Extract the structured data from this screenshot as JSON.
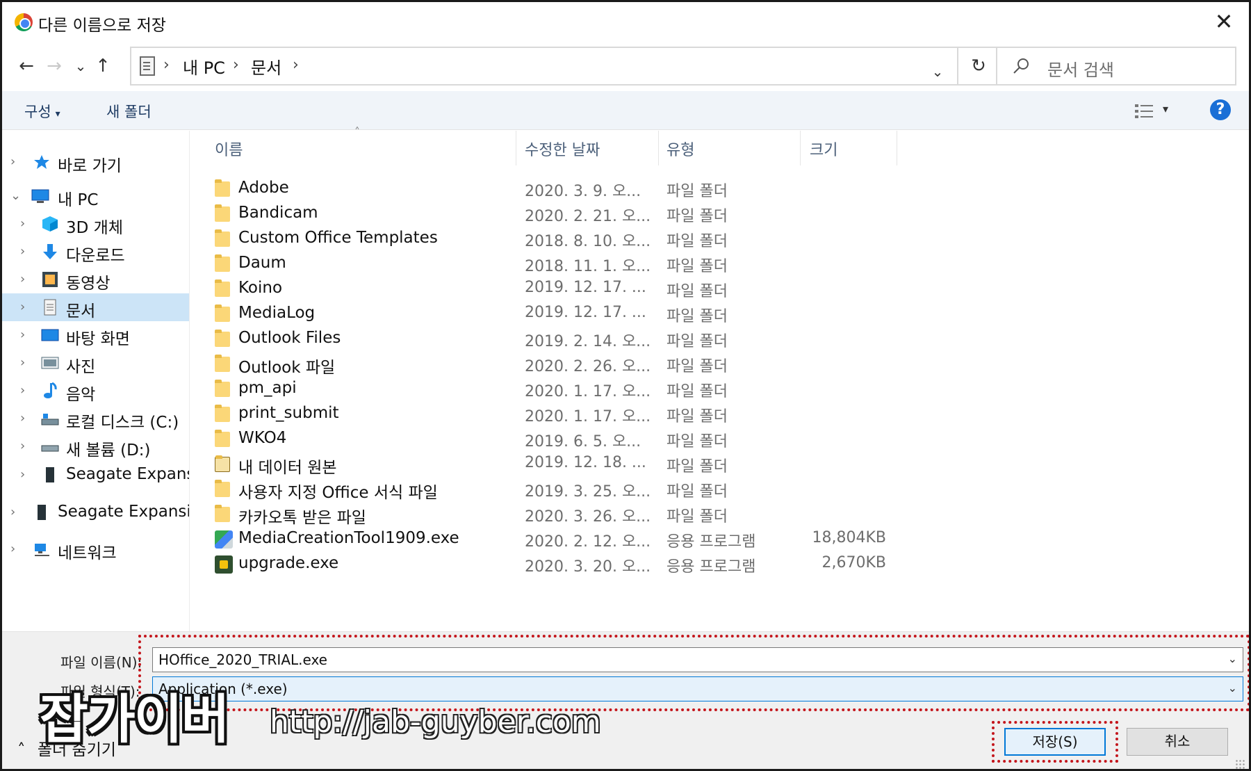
{
  "window": {
    "title": "다른 이름으로 저장",
    "close_glyph": "✕"
  },
  "nav": {
    "back_glyph": "←",
    "forward_glyph": "→",
    "recent_glyph": "⌄",
    "up_glyph": "↑",
    "refresh_glyph": "↻"
  },
  "address": {
    "sep": "›",
    "crumbs": [
      "내 PC",
      "문서"
    ],
    "dropdown_glyph": "⌄"
  },
  "search": {
    "placeholder": "문서 검색"
  },
  "toolbar": {
    "organize": "구성",
    "organize_caret": "▾",
    "new_folder": "새 폴더",
    "view_caret": "▾",
    "help": "?"
  },
  "navpane": {
    "chevron_right": "›",
    "chevron_down": "⌄",
    "items": [
      {
        "label": "바로 가기",
        "icon": "star-icon"
      },
      {
        "label": "내 PC",
        "icon": "pc-icon"
      },
      {
        "label": "3D 개체",
        "icon": "cube-icon"
      },
      {
        "label": "다운로드",
        "icon": "download-icon"
      },
      {
        "label": "동영상",
        "icon": "video-icon"
      },
      {
        "label": "문서",
        "icon": "document-icon",
        "selected": true
      },
      {
        "label": "바탕 화면",
        "icon": "desktop-icon"
      },
      {
        "label": "사진",
        "icon": "picture-icon"
      },
      {
        "label": "음악",
        "icon": "music-icon"
      },
      {
        "label": "로컬 디스크 (C:)",
        "icon": "drive-icon"
      },
      {
        "label": "새 볼륨 (D:)",
        "icon": "drive-icon"
      },
      {
        "label": "Seagate Expansion",
        "icon": "external-drive-icon"
      },
      {
        "label": "Seagate Expansion",
        "icon": "external-drive-icon"
      },
      {
        "label": "네트워크",
        "icon": "network-icon"
      }
    ]
  },
  "columns": {
    "sort_glyph": "˄",
    "name": "이름",
    "date": "수정한 날짜",
    "type": "유형",
    "size": "크기"
  },
  "files": [
    {
      "name": "Adobe",
      "date": "2020. 3. 9. 오...",
      "type": "파일 폴더",
      "size": "",
      "kind": "folder"
    },
    {
      "name": "Bandicam",
      "date": "2020. 2. 21. 오...",
      "type": "파일 폴더",
      "size": "",
      "kind": "folder"
    },
    {
      "name": "Custom Office Templates",
      "date": "2018. 8. 10. 오...",
      "type": "파일 폴더",
      "size": "",
      "kind": "folder"
    },
    {
      "name": "Daum",
      "date": "2018. 11. 1. 오...",
      "type": "파일 폴더",
      "size": "",
      "kind": "folder"
    },
    {
      "name": "Koino",
      "date": "2019. 12. 17. ...",
      "type": "파일 폴더",
      "size": "",
      "kind": "folder"
    },
    {
      "name": "MediaLog",
      "date": "2019. 12. 17. ...",
      "type": "파일 폴더",
      "size": "",
      "kind": "folder"
    },
    {
      "name": "Outlook Files",
      "date": "2019. 2. 14. 오...",
      "type": "파일 폴더",
      "size": "",
      "kind": "folder"
    },
    {
      "name": "Outlook 파일",
      "date": "2020. 2. 26. 오...",
      "type": "파일 폴더",
      "size": "",
      "kind": "folder"
    },
    {
      "name": "pm_api",
      "date": "2020. 1. 17. 오...",
      "type": "파일 폴더",
      "size": "",
      "kind": "folder"
    },
    {
      "name": "print_submit",
      "date": "2020. 1. 17. 오...",
      "type": "파일 폴더",
      "size": "",
      "kind": "folder"
    },
    {
      "name": "WKO4",
      "date": "2019. 6. 5. 오...",
      "type": "파일 폴더",
      "size": "",
      "kind": "folder"
    },
    {
      "name": "내 데이터 원본",
      "date": "2019. 12. 18. ...",
      "type": "파일 폴더",
      "size": "",
      "kind": "special-folder"
    },
    {
      "name": "사용자 지정 Office 서식 파일",
      "date": "2019. 3. 25. 오...",
      "type": "파일 폴더",
      "size": "",
      "kind": "folder"
    },
    {
      "name": "카카오톡 받은 파일",
      "date": "2020. 3. 26. 오...",
      "type": "파일 폴더",
      "size": "",
      "kind": "folder"
    },
    {
      "name": "MediaCreationTool1909.exe",
      "date": "2020. 2. 12. 오...",
      "type": "응용 프로그램",
      "size": "18,804KB",
      "kind": "exe-mct"
    },
    {
      "name": "upgrade.exe",
      "date": "2020. 3. 20. 오...",
      "type": "응용 프로그램",
      "size": "2,670KB",
      "kind": "exe-upg"
    }
  ],
  "form": {
    "filename_label": "파일 이름(N):",
    "filename_value": "HOffice_2020_TRIAL.exe",
    "filetype_label": "파일 형식(T):",
    "filetype_value": "Application (*.exe)",
    "caret_glyph": "⌄",
    "hide_folders": "폴더 숨기기",
    "hide_caret": "˄",
    "save": "저장(S)",
    "cancel": "취소"
  },
  "watermark": {
    "title": "잡가이버",
    "url": "http://jab-guyber.com"
  },
  "colors": {
    "highlight": "#c4161c",
    "selection": "#cce4f7",
    "accent": "#0078d7"
  }
}
